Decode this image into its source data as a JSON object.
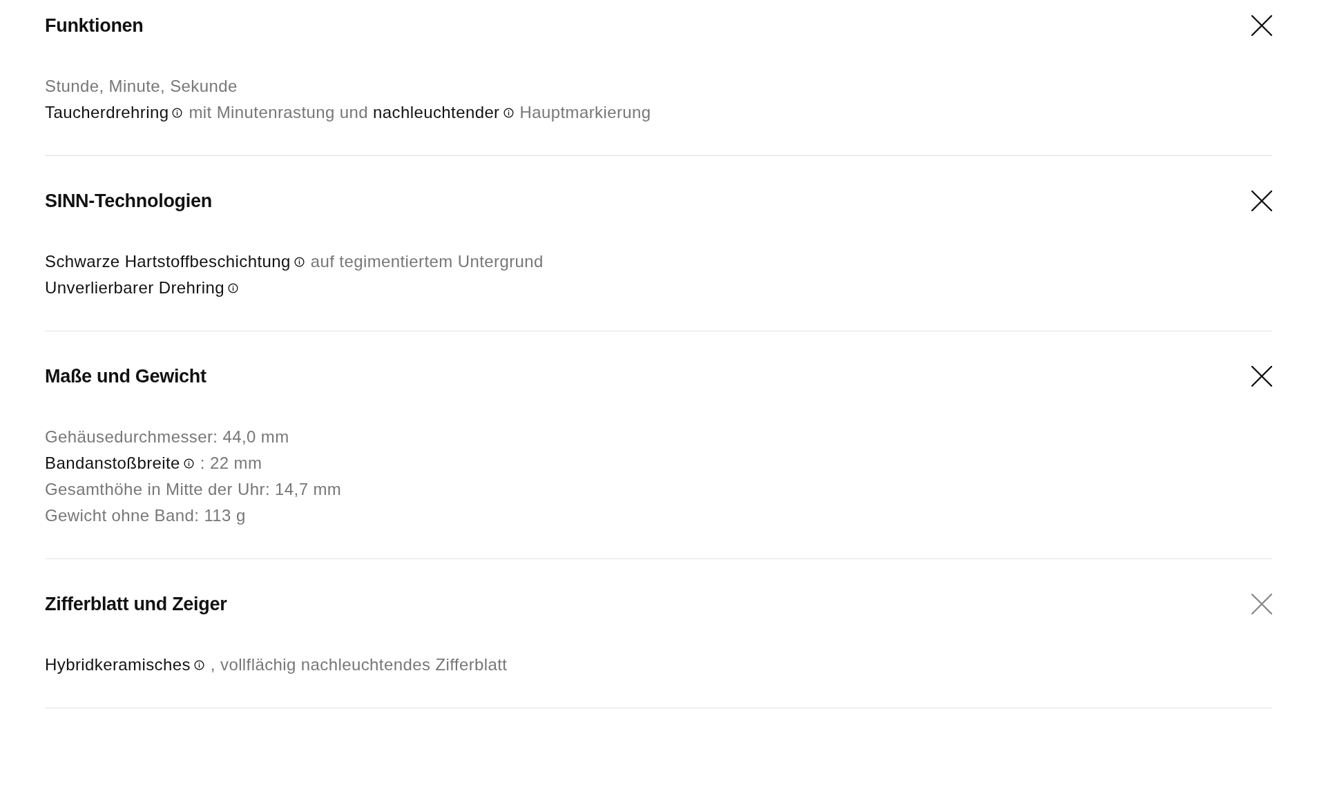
{
  "sections": [
    {
      "title": "Funktionen",
      "close_dimmed": false,
      "lines": [
        [
          {
            "text": "Stunde, Minute, Sekunde",
            "kind": "plain"
          }
        ],
        [
          {
            "text": "Taucherdrehring",
            "kind": "term"
          },
          {
            "text": "mit Minutenrastung und",
            "kind": "plain"
          },
          {
            "text": "nachleuchtender",
            "kind": "term"
          },
          {
            "text": "Hauptmarkierung",
            "kind": "plain"
          }
        ]
      ]
    },
    {
      "title": "SINN-Technologien",
      "close_dimmed": false,
      "lines": [
        [
          {
            "text": "Schwarze Hartstoffbeschichtung",
            "kind": "term"
          },
          {
            "text": "auf tegimentiertem Untergrund",
            "kind": "plain"
          }
        ],
        [
          {
            "text": "Unverlierbarer Drehring",
            "kind": "term"
          }
        ]
      ]
    },
    {
      "title": "Maße und Gewicht",
      "close_dimmed": false,
      "lines": [
        [
          {
            "text": "Gehäusedurchmesser: 44,0 mm",
            "kind": "plain"
          }
        ],
        [
          {
            "text": "Bandanstoßbreite",
            "kind": "term"
          },
          {
            "text": ": 22 mm",
            "kind": "plain"
          }
        ],
        [
          {
            "text": "Gesamthöhe in Mitte der Uhr: 14,7 mm",
            "kind": "plain"
          }
        ],
        [
          {
            "text": "Gewicht ohne Band: 113 g",
            "kind": "plain"
          }
        ]
      ]
    },
    {
      "title": "Zifferblatt und Zeiger",
      "close_dimmed": true,
      "lines": [
        [
          {
            "text": "Hybridkeramisches",
            "kind": "term"
          },
          {
            "text": ", vollflächig nachleuchtendes Zifferblatt",
            "kind": "plain"
          }
        ]
      ]
    }
  ]
}
